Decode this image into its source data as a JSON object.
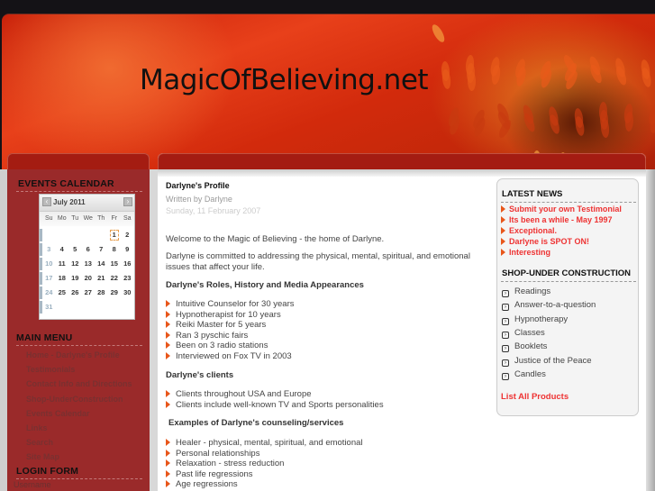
{
  "site": {
    "title": "MagicOfBelieving.net"
  },
  "events_calendar": {
    "title": "EVENTS CALENDAR",
    "month": "July 2011",
    "prev_icon": "chevron-left-icon",
    "next_icon": "chevron-right-icon",
    "weekdays": [
      "Su",
      "Mo",
      "Tu",
      "We",
      "Th",
      "Fr",
      "Sa"
    ],
    "weeks": [
      [
        "",
        "",
        "",
        "",
        "",
        "1",
        "2"
      ],
      [
        "3",
        "4",
        "5",
        "6",
        "7",
        "8",
        "9"
      ],
      [
        "10",
        "11",
        "12",
        "13",
        "14",
        "15",
        "16"
      ],
      [
        "17",
        "18",
        "19",
        "20",
        "21",
        "22",
        "23"
      ],
      [
        "24",
        "25",
        "26",
        "27",
        "28",
        "29",
        "30"
      ],
      [
        "31",
        "",
        "",
        "",
        "",
        "",
        ""
      ]
    ],
    "today": "1"
  },
  "main_menu": {
    "title": "MAIN MENU",
    "items": [
      "Home - Darlyne's Profile",
      "Testimonials",
      "Contact Info and Directions",
      "Shop-UnderConstruction",
      "Events Calendar",
      "Links",
      "Search",
      "Site Map"
    ]
  },
  "login_form": {
    "title": "LOGIN FORM",
    "username_label": "Username"
  },
  "article": {
    "title": "Darlyne's Profile",
    "author": "Written by Darlyne",
    "date": "Sunday, 11 February 2007",
    "intro": "Welcome to the Magic of Believing - the home of Darlyne.",
    "commitment": "Darlyne is committed to addressing the physical, mental, spiritual, and emotional issues that  affect your life.",
    "roles_heading": "Darlyne's Roles, History and Media Appearances",
    "roles": [
      "Intuitive Counselor for 30 years",
      "Hypnotherapist for 10 years",
      "Reiki Master for 5 years",
      "Ran 3 pyschic fairs",
      "Been on 3 radio stations",
      "Interviewed on Fox TV in 2003"
    ],
    "clients_heading": "Darlyne's clients",
    "clients": [
      "Clients throughout USA and Europe",
      "Clients include well-known TV and Sports personalities"
    ],
    "services_heading": "Examples of  Darlyne's counseling/services",
    "services": [
      "Healer -  physical, mental, spiritual, and emotional",
      "Personal relationships",
      "Relaxation - stress reduction",
      "Past life regressions",
      "Age regressions"
    ]
  },
  "latest_news": {
    "title": "LATEST NEWS",
    "items": [
      "Submit your own Testimonial",
      "Its been a while - May 1997",
      "Exceptional.",
      "Darlyne is SPOT ON!",
      "Interesting"
    ]
  },
  "shop": {
    "title": "SHOP-UNDER CONSTRUCTION",
    "items": [
      "Readings",
      "Answer-to-a-question",
      "Hypnotherapy",
      "Classes",
      "Booklets",
      "Justice of the Peace",
      "Candles"
    ],
    "list_all": "List All Products"
  },
  "colors": {
    "accent_red": "#ee3333",
    "bullet_orange": "#e8561a",
    "sidebar_red": "#9a2a2a"
  }
}
